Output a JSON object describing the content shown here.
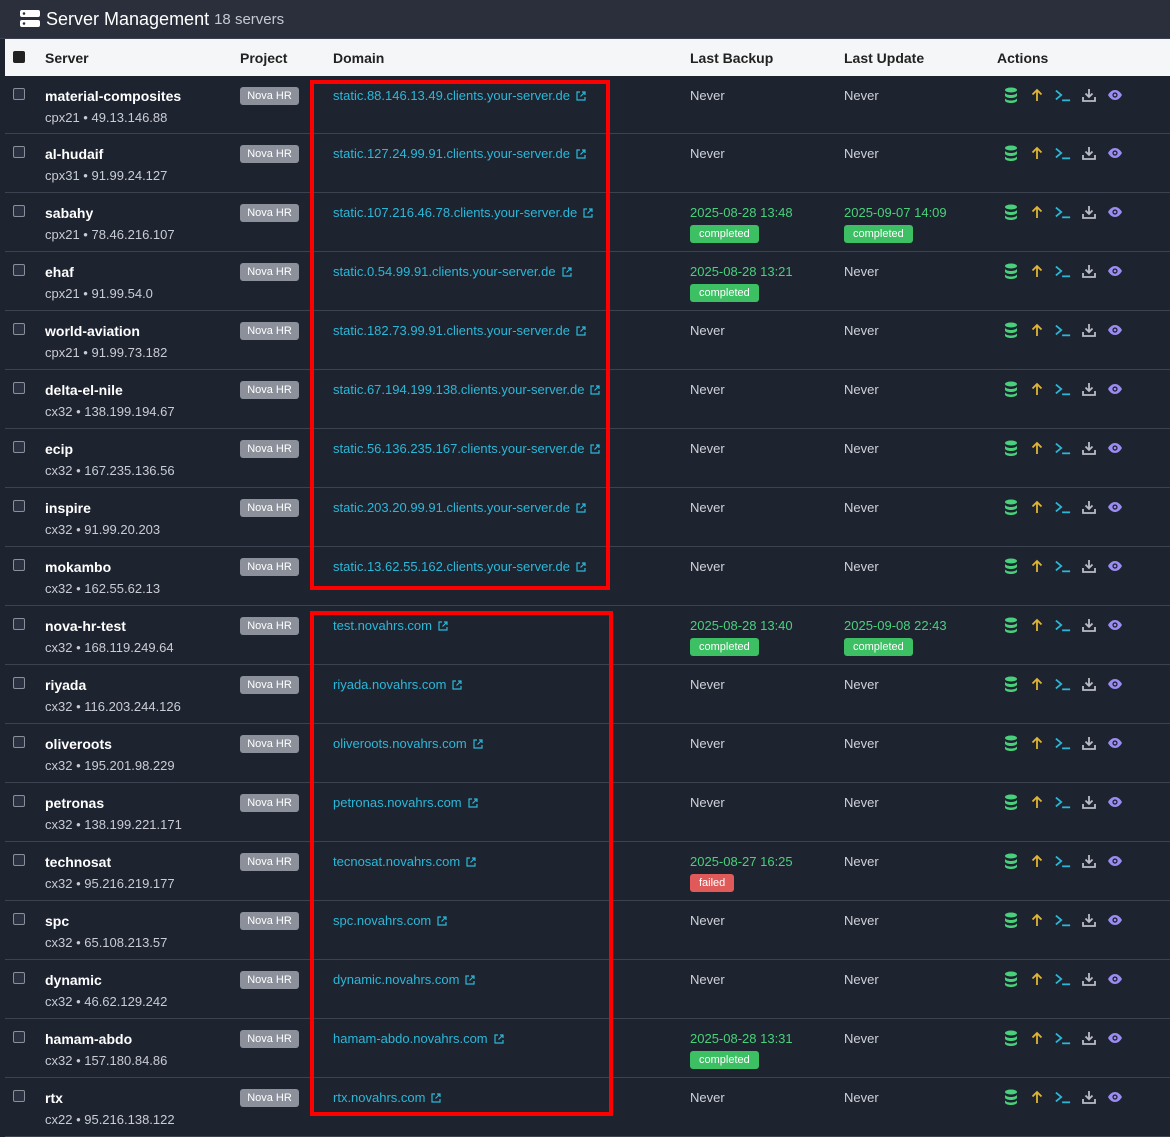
{
  "header": {
    "title": "Server Management",
    "count": "18 servers",
    "icon": "server-icon"
  },
  "columns": {
    "server": "Server",
    "project": "Project",
    "domain": "Domain",
    "last_backup": "Last Backup",
    "last_update": "Last Update",
    "actions": "Actions"
  },
  "colors": {
    "accent": "#2bb8d8",
    "success": "#3dbf63",
    "danger": "#e05a5a",
    "highlight": "#ff0000"
  },
  "servers": [
    {
      "name": "material-composites",
      "sub": "cpx21 • 49.13.146.88",
      "project": "Nova HR",
      "domain": "static.88.146.13.49.clients.your-server.de",
      "backup": "Never",
      "backup_status": "",
      "update": "Never",
      "update_status": ""
    },
    {
      "name": "al-hudaif",
      "sub": "cpx31 • 91.99.24.127",
      "project": "Nova HR",
      "domain": "static.127.24.99.91.clients.your-server.de",
      "backup": "Never",
      "backup_status": "",
      "update": "Never",
      "update_status": ""
    },
    {
      "name": "sabahy",
      "sub": "cpx21 • 78.46.216.107",
      "project": "Nova HR",
      "domain": "static.107.216.46.78.clients.your-server.de",
      "backup": "2025-08-28 13:48",
      "backup_status": "completed",
      "update": "2025-09-07 14:09",
      "update_status": "completed"
    },
    {
      "name": "ehaf",
      "sub": "cpx21 • 91.99.54.0",
      "project": "Nova HR",
      "domain": "static.0.54.99.91.clients.your-server.de",
      "backup": "2025-08-28 13:21",
      "backup_status": "completed",
      "update": "Never",
      "update_status": ""
    },
    {
      "name": "world-aviation",
      "sub": "cpx21 • 91.99.73.182",
      "project": "Nova HR",
      "domain": "static.182.73.99.91.clients.your-server.de",
      "backup": "Never",
      "backup_status": "",
      "update": "Never",
      "update_status": ""
    },
    {
      "name": "delta-el-nile",
      "sub": "cx32 • 138.199.194.67",
      "project": "Nova HR",
      "domain": "static.67.194.199.138.clients.your-server.de",
      "backup": "Never",
      "backup_status": "",
      "update": "Never",
      "update_status": ""
    },
    {
      "name": "ecip",
      "sub": "cx32 • 167.235.136.56",
      "project": "Nova HR",
      "domain": "static.56.136.235.167.clients.your-server.de",
      "backup": "Never",
      "backup_status": "",
      "update": "Never",
      "update_status": ""
    },
    {
      "name": "inspire",
      "sub": "cx32 • 91.99.20.203",
      "project": "Nova HR",
      "domain": "static.203.20.99.91.clients.your-server.de",
      "backup": "Never",
      "backup_status": "",
      "update": "Never",
      "update_status": ""
    },
    {
      "name": "mokambo",
      "sub": "cx32 • 162.55.62.13",
      "project": "Nova HR",
      "domain": "static.13.62.55.162.clients.your-server.de",
      "backup": "Never",
      "backup_status": "",
      "update": "Never",
      "update_status": ""
    },
    {
      "name": "nova-hr-test",
      "sub": "cx32 • 168.119.249.64",
      "project": "Nova HR",
      "domain": "test.novahrs.com",
      "backup": "2025-08-28 13:40",
      "backup_status": "completed",
      "update": "2025-09-08 22:43",
      "update_status": "completed"
    },
    {
      "name": "riyada",
      "sub": "cx32 • 116.203.244.126",
      "project": "Nova HR",
      "domain": "riyada.novahrs.com",
      "backup": "Never",
      "backup_status": "",
      "update": "Never",
      "update_status": ""
    },
    {
      "name": "oliveroots",
      "sub": "cx32 • 195.201.98.229",
      "project": "Nova HR",
      "domain": "oliveroots.novahrs.com",
      "backup": "Never",
      "backup_status": "",
      "update": "Never",
      "update_status": ""
    },
    {
      "name": "petronas",
      "sub": "cx32 • 138.199.221.171",
      "project": "Nova HR",
      "domain": "petronas.novahrs.com",
      "backup": "Never",
      "backup_status": "",
      "update": "Never",
      "update_status": ""
    },
    {
      "name": "technosat",
      "sub": "cx32 • 95.216.219.177",
      "project": "Nova HR",
      "domain": "tecnosat.novahrs.com",
      "backup": "2025-08-27 16:25",
      "backup_status": "failed",
      "update": "Never",
      "update_status": ""
    },
    {
      "name": "spc",
      "sub": "cx32 • 65.108.213.57",
      "project": "Nova HR",
      "domain": "spc.novahrs.com",
      "backup": "Never",
      "backup_status": "",
      "update": "Never",
      "update_status": ""
    },
    {
      "name": "dynamic",
      "sub": "cx32 • 46.62.129.242",
      "project": "Nova HR",
      "domain": "dynamic.novahrs.com",
      "backup": "Never",
      "backup_status": "",
      "update": "Never",
      "update_status": ""
    },
    {
      "name": "hamam-abdo",
      "sub": "cx32 • 157.180.84.86",
      "project": "Nova HR",
      "domain": "hamam-abdo.novahrs.com",
      "backup": "2025-08-28 13:31",
      "backup_status": "completed",
      "update": "Never",
      "update_status": ""
    },
    {
      "name": "rtx",
      "sub": "cx22 • 95.216.138.122",
      "project": "Nova HR",
      "domain": "rtx.novahrs.com",
      "backup": "Never",
      "backup_status": "",
      "update": "Never",
      "update_status": ""
    }
  ],
  "action_icons": [
    "backup-database-icon",
    "update-arrow-icon",
    "terminal-icon",
    "download-icon",
    "view-eye-icon"
  ]
}
